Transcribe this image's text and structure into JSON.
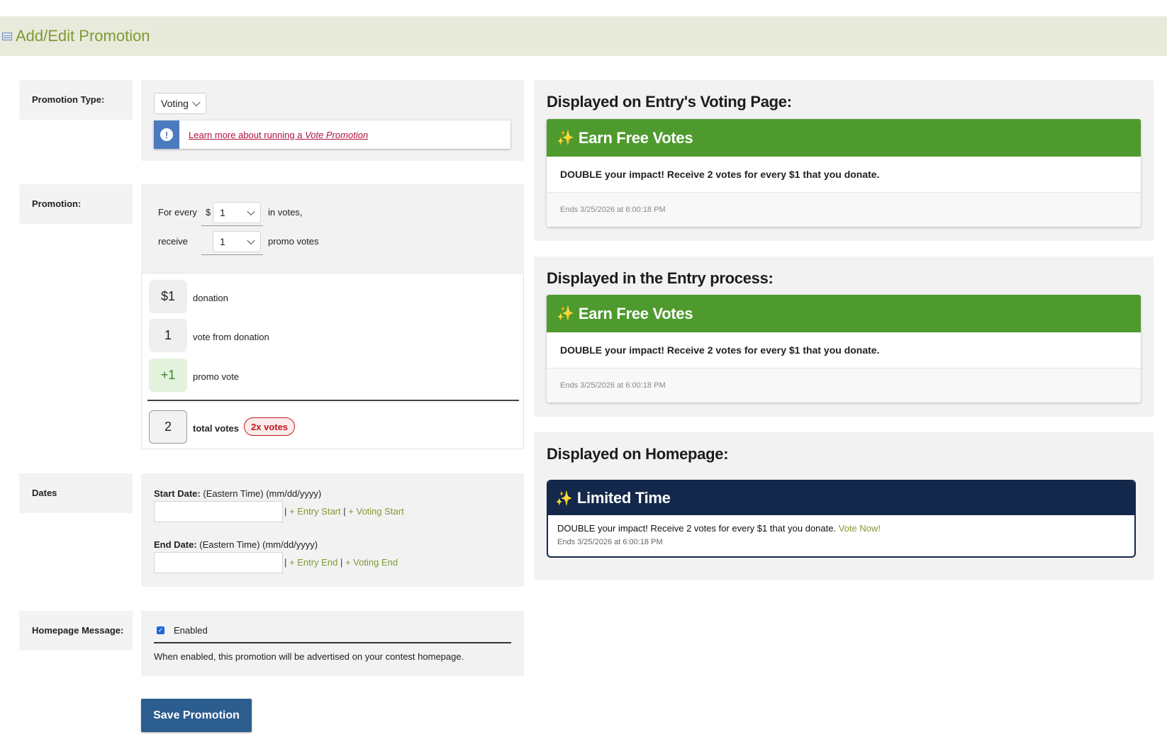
{
  "header": {
    "title": "Add/Edit Promotion"
  },
  "promotion_type": {
    "label": "Promotion Type:",
    "selected": "Voting",
    "info_link_prefix": "Learn more about running a ",
    "info_link_emphasis": "Vote Promotion"
  },
  "promotion": {
    "label": "Promotion:",
    "for_every": "For every",
    "currency": "$",
    "donation_amount": "1",
    "in_votes": "in votes,",
    "receive": "receive",
    "promo_amount": "1",
    "promo_votes": "promo votes"
  },
  "calculator": {
    "donation_value": "$1",
    "donation_label": "donation",
    "votes_value": "1",
    "votes_label": "vote from donation",
    "promo_value": "+1",
    "promo_label": "promo vote",
    "total_value": "2",
    "total_label": "total votes",
    "multiplier_badge": "2x votes"
  },
  "dates": {
    "label": "Dates",
    "start_label": "Start Date:",
    "start_hint": " (Eastern Time) (mm/dd/yyyy)",
    "start_value": "",
    "entry_start": "+ Entry Start",
    "voting_start": "+ Voting Start",
    "end_label": "End Date:",
    "end_hint": " (Eastern Time) (mm/dd/yyyy)",
    "end_value": "",
    "entry_end": "+ Entry End",
    "voting_end": "+ Voting End",
    "separator": "|"
  },
  "homepage": {
    "label": "Homepage Message:",
    "checkbox_label": "Enabled",
    "checked": true,
    "help_text": "When enabled, this promotion will be advertised on your contest homepage."
  },
  "save_button": "Save Promotion",
  "previews": {
    "voting_page": {
      "title": "Displayed on Entry's Voting Page:",
      "heading": "Earn Free Votes",
      "message": "DOUBLE your impact! Receive 2 votes for every $1 that you donate.",
      "ends": "Ends 3/25/2026 at 6:00:18 PM"
    },
    "entry_process": {
      "title": "Displayed in the Entry process:",
      "heading": "Earn Free Votes",
      "message": "DOUBLE your impact! Receive 2 votes for every $1 that you donate.",
      "ends": "Ends 3/25/2026 at 6:00:18 PM"
    },
    "homepage": {
      "title": "Displayed on Homepage:",
      "heading": "Limited Time",
      "message": "DOUBLE your impact! Receive 2 votes for every $1 that you donate.",
      "cta": "Vote Now!",
      "ends": "Ends 3/25/2026 at 6:00:18 PM"
    }
  },
  "icons": {
    "sparkle": "✨",
    "info": "!",
    "check": "✓"
  },
  "colors": {
    "header_bg": "#e8eadb",
    "header_text": "#7f9a33",
    "green_banner": "#4f9a2e",
    "navy_banner": "#13284a",
    "save_button": "#2c5d8f",
    "link_red": "#b0123c",
    "badge_red": "#c0161d",
    "info_blue": "#4b7bbe",
    "promo_tile": "#e3f2dd"
  }
}
